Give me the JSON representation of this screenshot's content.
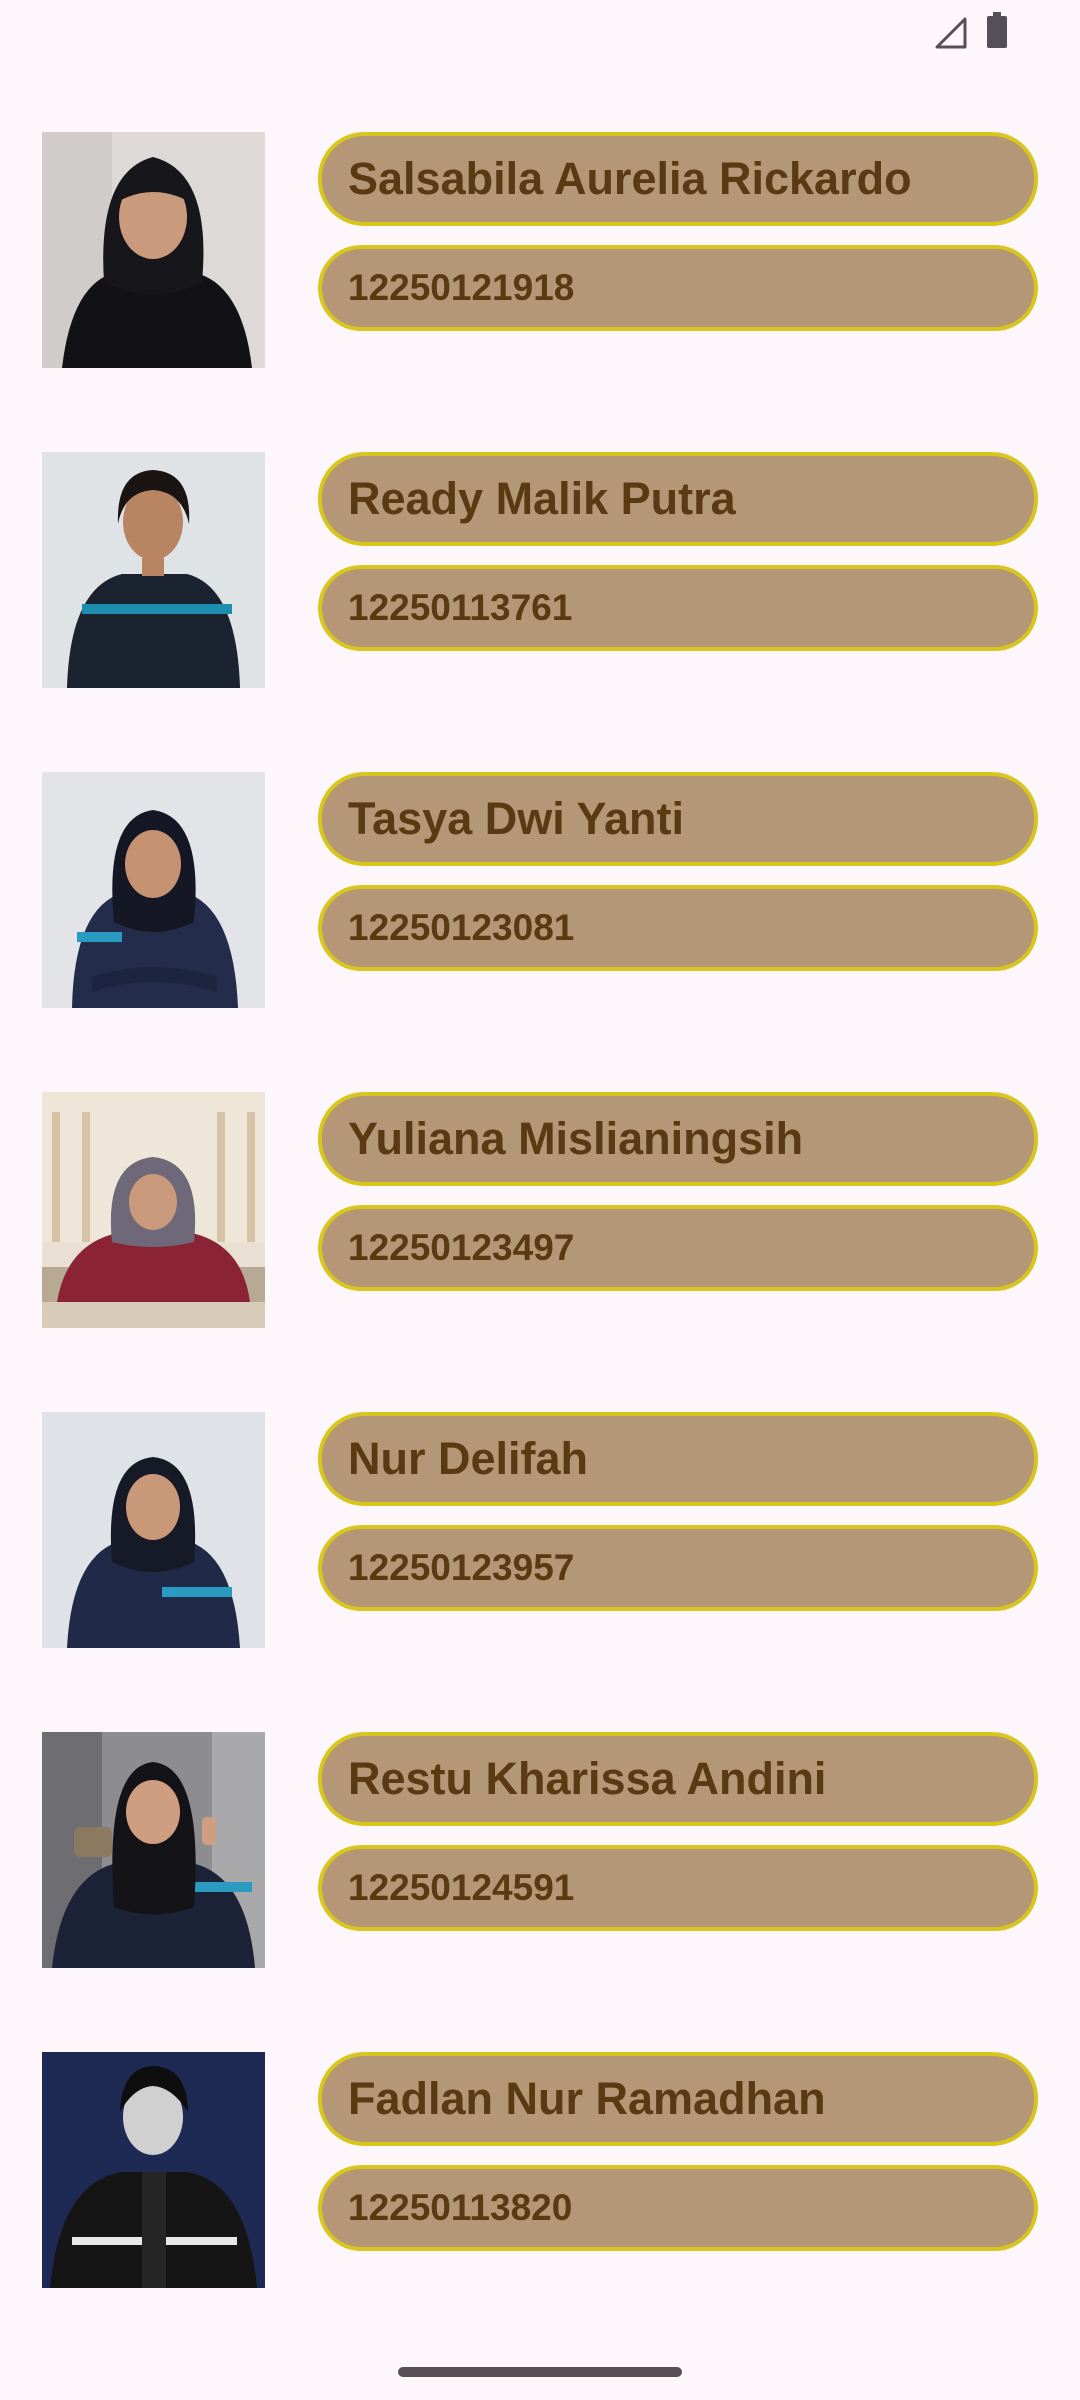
{
  "status_bar": {
    "icons": [
      "signal-icon",
      "battery-icon"
    ]
  },
  "colors": {
    "background": "#fdf7fc",
    "pill_fill": "#b39777",
    "pill_border": "#d9c61c",
    "pill_text": "#5a3a12"
  },
  "members": [
    {
      "name": "Salsabila Aurelia Rickardo",
      "nim": "12250121918"
    },
    {
      "name": "Ready Malik Putra",
      "nim": "12250113761"
    },
    {
      "name": "Tasya Dwi Yanti",
      "nim": "12250123081"
    },
    {
      "name": "Yuliana Mislianingsih",
      "nim": "12250123497"
    },
    {
      "name": "Nur Delifah",
      "nim": "12250123957"
    },
    {
      "name": "Restu Kharissa Andini",
      "nim": "12250124591"
    },
    {
      "name": "Fadlan Nur Ramadhan",
      "nim": "12250113820"
    }
  ]
}
